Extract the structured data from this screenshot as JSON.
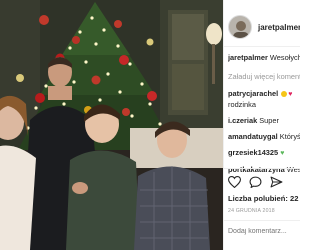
{
  "post": {
    "username": "jaretpalmer",
    "caption_tail": "Wesołych",
    "load_more": "Załaduj więcej komentarzy",
    "comments": [
      {
        "user": "patrycjarachel",
        "text": "rodzinka"
      },
      {
        "user": "i.czeriak",
        "text": "Super"
      },
      {
        "user": "amandatuygal",
        "text": "Któryś z nich jest podobny do mamy .O drugi podobny do Ani a jedo"
      },
      {
        "user": "grzesiek14325",
        "text": ""
      },
      {
        "user": "portkakatarzyna",
        "text": "Wesoł"
      }
    ],
    "likes": "Liczba polubień: 22 4",
    "date": "24 GRUDNIA 2018",
    "add_comment_placeholder": "Dodaj komentarz..."
  },
  "icons": {
    "like": "heart-icon",
    "comment": "comment-icon",
    "share": "share-icon",
    "avatar": "avatar"
  }
}
